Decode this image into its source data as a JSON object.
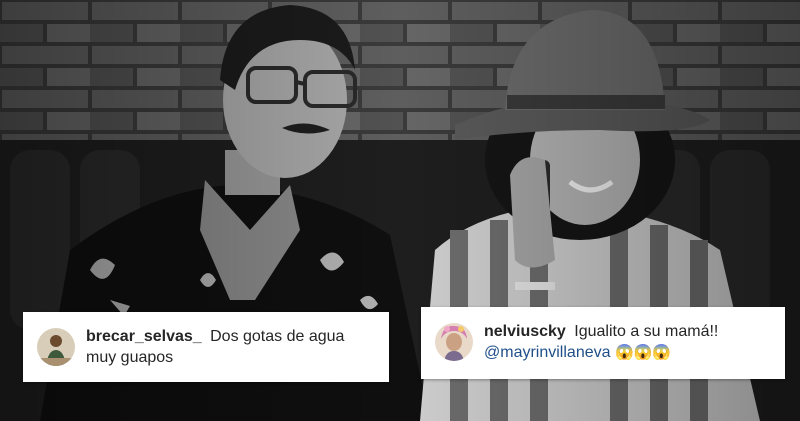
{
  "comments": [
    {
      "username": "brecar_selvas_",
      "text": "Dos gotas de agua muy guapos",
      "avatar_icon": "profile-photo-avatar"
    },
    {
      "username": "nelviuscky",
      "text": "Igualito a su mamá!!",
      "mention": "@mayrinvillaneva",
      "emojis": "😱😱😱",
      "avatar_icon": "profile-photo-avatar"
    }
  ],
  "colors": {
    "card_background": "#ffffff",
    "text": "#262626",
    "mention": "#1f4f8a"
  }
}
